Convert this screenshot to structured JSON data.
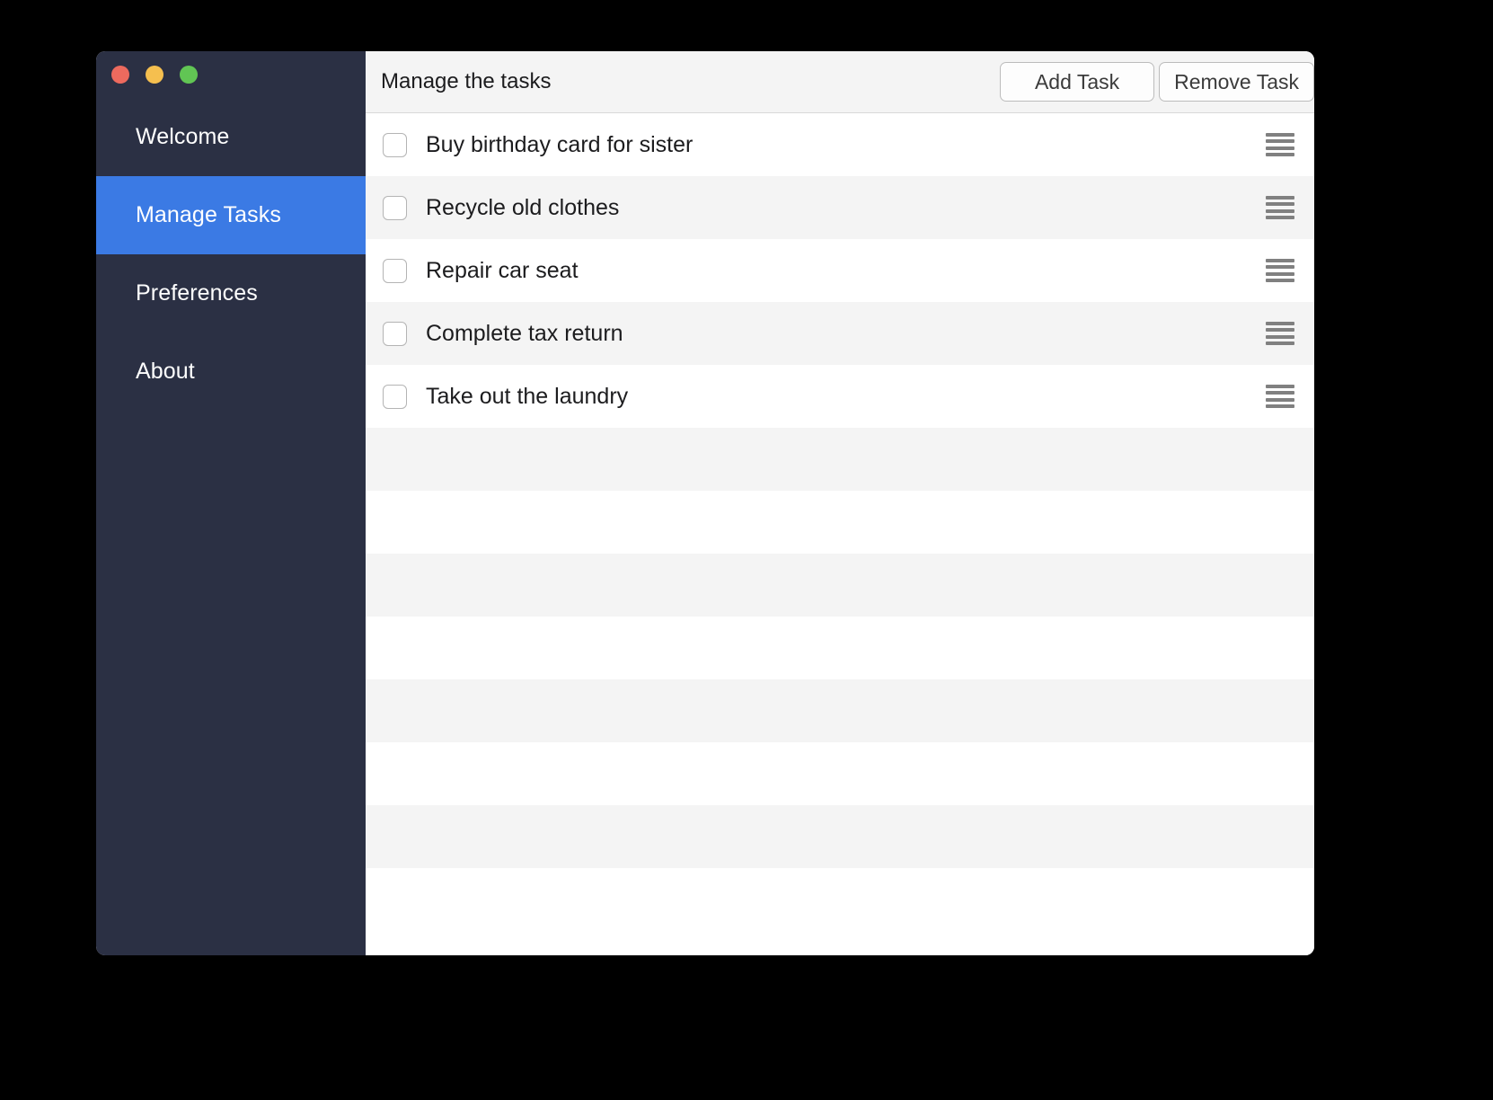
{
  "window": {
    "traffic_lights": [
      {
        "name": "close",
        "color": "#ed6a5e"
      },
      {
        "name": "minimize",
        "color": "#f5bf4f"
      },
      {
        "name": "zoom",
        "color": "#61c554"
      }
    ]
  },
  "sidebar": {
    "accent_color": "#3b7ae4",
    "background_color": "#2b3044",
    "items": [
      {
        "label": "Welcome",
        "active": false
      },
      {
        "label": "Manage Tasks",
        "active": true
      },
      {
        "label": "Preferences",
        "active": false
      },
      {
        "label": "About",
        "active": false
      }
    ]
  },
  "toolbar": {
    "title": "Manage the tasks",
    "add_label": "Add Task",
    "remove_label": "Remove Task"
  },
  "tasks": {
    "items": [
      {
        "label": "Buy birthday card for sister",
        "checked": false
      },
      {
        "label": "Recycle old clothes",
        "checked": false
      },
      {
        "label": "Repair car seat",
        "checked": false
      },
      {
        "label": "Complete tax return",
        "checked": false
      },
      {
        "label": "Take out the laundry",
        "checked": false
      }
    ],
    "empty_row_count": 8
  }
}
